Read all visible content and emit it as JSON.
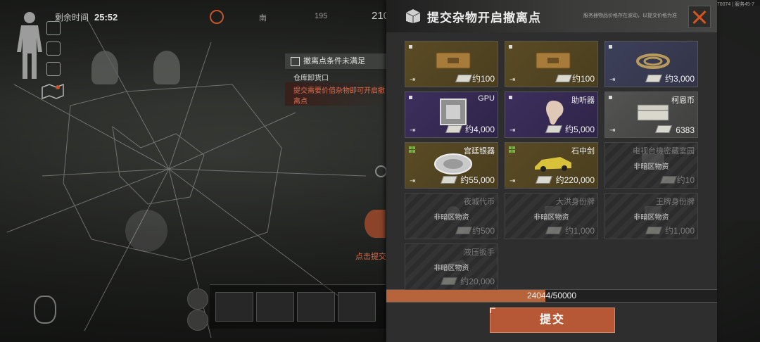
{
  "hud": {
    "time_label": "剩余时间",
    "time_value": "25:52",
    "compass": {
      "south": "南",
      "deg1": "195",
      "deg2": "210"
    },
    "task_title": "撤离点条件未满足",
    "task_line1": "仓库卸货口",
    "task_line2": "提交需要价值杂物即可开启撤离点",
    "action_hint": "点击提交",
    "version": "1.0.165.165(15) | 05171531 | 9613470074 | 服务45-7"
  },
  "panel": {
    "title": "提交杂物开启撤离点",
    "note": "服务器物品价格存在波动，以提交价格为准",
    "items": [
      {
        "name": "",
        "value": "约100",
        "rarity": "gold",
        "icon": "ammo-box-icon",
        "disabled": false
      },
      {
        "name": "",
        "value": "约100",
        "rarity": "gold",
        "icon": "ammo-box-icon",
        "disabled": false
      },
      {
        "name": "",
        "value": "约3,000",
        "rarity": "navy",
        "icon": "rope-icon",
        "disabled": false
      },
      {
        "name": "GPU",
        "value": "约4,000",
        "rarity": "purple",
        "icon": "gpu-chip-icon",
        "disabled": false
      },
      {
        "name": "助听器",
        "value": "约5,000",
        "rarity": "purple",
        "icon": "hearing-aid-icon",
        "disabled": false
      },
      {
        "name": "柯恩币",
        "value": "6383",
        "rarity": "grey",
        "icon": "cash-stack-icon",
        "disabled": false
      },
      {
        "name": "宫廷银器",
        "value": "约55,000",
        "rarity": "gold",
        "icon": "silver-plate-icon",
        "disabled": false
      },
      {
        "name": "石中剑",
        "value": "约220,000",
        "rarity": "gold",
        "icon": "sports-car-icon",
        "disabled": false
      },
      {
        "name": "电视台機密藏室园",
        "value": "约10",
        "rarity": "dis",
        "icon": "keycard-icon",
        "disabled": true
      },
      {
        "name": "夜城代币",
        "value": "约500",
        "rarity": "dis",
        "icon": "token-icon",
        "disabled": true
      },
      {
        "name": "大洪身份牌",
        "value": "约1,000",
        "rarity": "dis",
        "icon": "id-tag-icon",
        "disabled": true
      },
      {
        "name": "王牌身份牌",
        "value": "约1,000",
        "rarity": "dis",
        "icon": "id-tag-icon",
        "disabled": true
      },
      {
        "name": "液压扳手",
        "value": "约20,000",
        "rarity": "dis",
        "icon": "wrench-icon",
        "disabled": true
      }
    ],
    "disabled_label": "非暗区物资",
    "progress_text": "24044/50000",
    "progress_fraction": 0.4809,
    "submit_label": "提交"
  }
}
